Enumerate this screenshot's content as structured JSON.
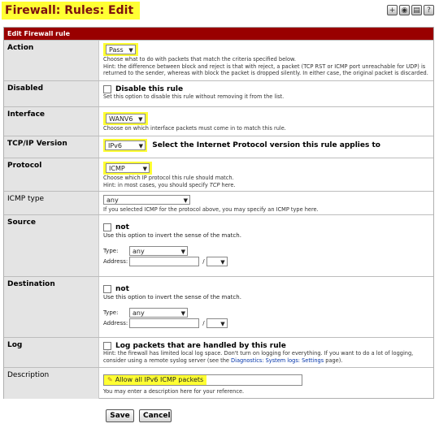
{
  "page_title": "Firewall: Rules: Edit",
  "header_icons": [
    "add-icon",
    "info-icon",
    "log-icon",
    "help-icon"
  ],
  "section_title": "Edit Firewall rule",
  "action": {
    "label": "Action",
    "value": "Pass",
    "help1": "Choose what to do with packets that match the criteria specified below.",
    "help2": "Hint: the difference between block and reject is that with reject, a packet (TCP RST or ICMP port unreachable for UDP) is",
    "help3": "returned to the sender, whereas with block the packet is dropped silently. In either case, the original packet is discarded."
  },
  "disabled": {
    "label": "Disabled",
    "checkbox_label": "Disable this rule",
    "help": "Set this option to disable this rule without removing it from the list."
  },
  "interface": {
    "label": "Interface",
    "value": "WANV6",
    "help": "Choose on which interface packets must come in to match this rule."
  },
  "tcpip": {
    "label": "TCP/IP Version",
    "value": "IPv6",
    "help": "Select the Internet Protocol version this rule applies to"
  },
  "protocol": {
    "label": "Protocol",
    "value": "ICMP",
    "help1": "Choose which IP protocol this rule should match.",
    "help2_prefix": "Hint: in most cases, you should specify ",
    "help2_em": "TCP",
    "help2_suffix": " here."
  },
  "icmp_type": {
    "label": "ICMP type",
    "value": "any",
    "help": "If you selected ICMP for the protocol above, you may specify an ICMP type here."
  },
  "source": {
    "label": "Source",
    "not_label": "not",
    "help": "Use this option to invert the sense of the match.",
    "type_label": "Type:",
    "type_value": "any",
    "address_label": "Address:",
    "slash": "/"
  },
  "destination": {
    "label": "Destination",
    "not_label": "not",
    "help": "Use this option to invert the sense of the match.",
    "type_label": "Type:",
    "type_value": "any",
    "address_label": "Address:",
    "slash": "/"
  },
  "log": {
    "label": "Log",
    "checkbox_label": "Log packets that are handled by this rule",
    "help1": "Hint: the firewall has limited local log space. Don't turn on logging for everything. If you want to do a lot of logging,",
    "help2_prefix": "consider using a remote syslog server (see the ",
    "help2_link": "Diagnostics: System logs: Settings",
    "help2_suffix": " page)."
  },
  "description": {
    "label": "Description",
    "value": "Allow all IPv6 ICMP packets",
    "help": "You may enter a description here for your reference."
  },
  "buttons": {
    "save": "Save",
    "cancel": "Cancel"
  },
  "colors": {
    "header_bg": "#990000",
    "title_color": "#7a1010",
    "highlight": "#ffff33",
    "label_bg": "#e4e4e4"
  }
}
